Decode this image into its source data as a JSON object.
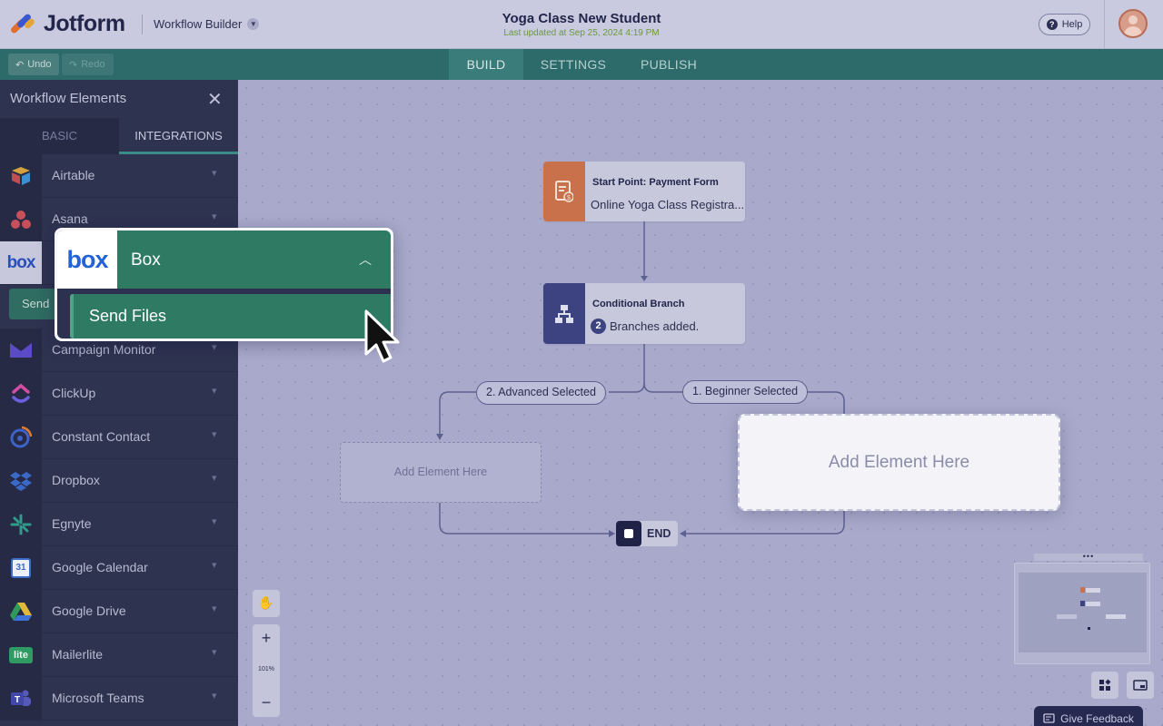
{
  "app": {
    "brand": "Jotform",
    "section": "Workflow Builder",
    "title": "Yoga Class New Student",
    "last_updated": "Last updated at Sep 25, 2024 4:19 PM",
    "help": "Help"
  },
  "toolbar": {
    "undo": "Undo",
    "redo": "Redo",
    "tabs": [
      "BUILD",
      "SETTINGS",
      "PUBLISH"
    ],
    "active_tab": "BUILD"
  },
  "panel": {
    "title": "Workflow Elements",
    "tabs": [
      "BASIC",
      "INTEGRATIONS"
    ],
    "active_tab": "INTEGRATIONS",
    "items": [
      {
        "label": "Airtable",
        "icon": "airtable-icon"
      },
      {
        "label": "Asana",
        "icon": "asana-icon"
      },
      {
        "label": "Box",
        "icon": "box-icon"
      },
      {
        "label": "Campaign Monitor",
        "icon": "campaign-monitor-icon"
      },
      {
        "label": "ClickUp",
        "icon": "clickup-icon"
      },
      {
        "label": "Constant Contact",
        "icon": "constant-contact-icon"
      },
      {
        "label": "Dropbox",
        "icon": "dropbox-icon"
      },
      {
        "label": "Egnyte",
        "icon": "egnyte-icon"
      },
      {
        "label": "Google Calendar",
        "icon": "google-calendar-icon"
      },
      {
        "label": "Google Drive",
        "icon": "google-drive-icon"
      },
      {
        "label": "Mailerlite",
        "icon": "mailerlite-icon"
      },
      {
        "label": "Microsoft Teams",
        "icon": "microsoft-teams-icon"
      }
    ],
    "send_behind": "Send",
    "calendar_day": "31",
    "mailerlite_mark": "lite"
  },
  "box_popup": {
    "logo": "box",
    "label": "Box",
    "action": "Send Files"
  },
  "flow": {
    "start": {
      "title": "Start Point: Payment Form",
      "subtitle": "Online Yoga Class Registra..."
    },
    "branch": {
      "title": "Conditional Branch",
      "count": "2",
      "subtitle": "Branches added."
    },
    "branch_left": "2. Advanced Selected",
    "branch_right": "1. Beginner Selected",
    "add_small": "Add Element Here",
    "add_big": "Add Element Here",
    "end": "END"
  },
  "controls": {
    "zoom": "101%",
    "zoom_in": "+",
    "zoom_out": "−",
    "feedback": "Give Feedback",
    "minimap_handle": "•••"
  },
  "colors": {
    "teal": "#2d6b6b",
    "box_green": "#2f7a62",
    "panel_bg": "#2e3350",
    "start_icon": "#c9714a",
    "branch_icon": "#3c4380"
  }
}
